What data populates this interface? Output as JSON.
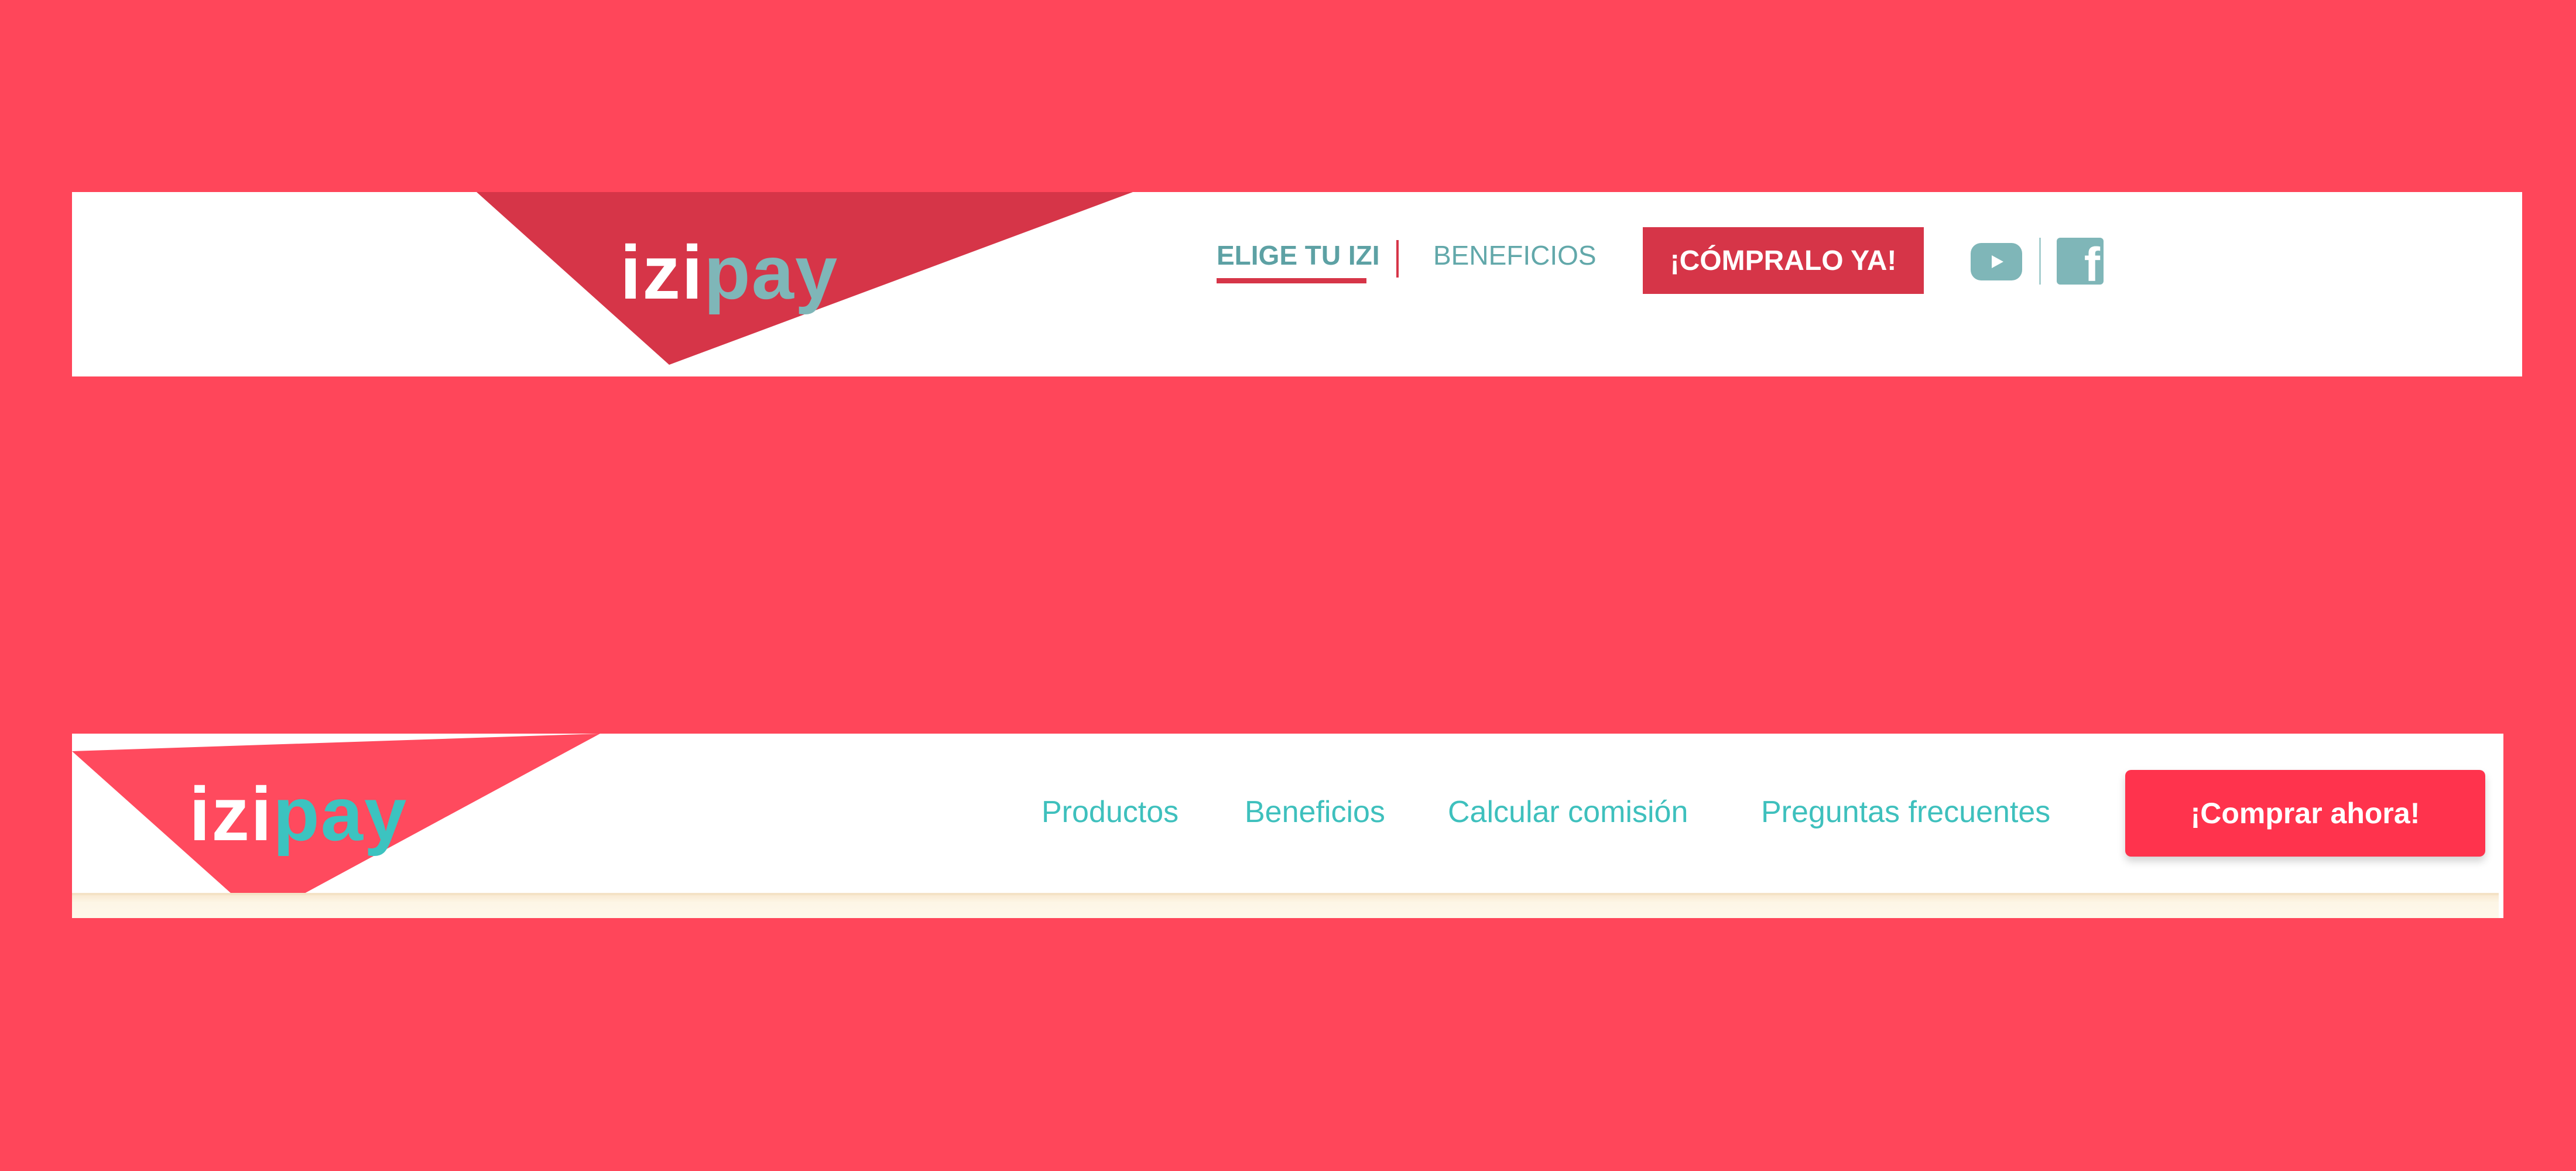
{
  "colors": {
    "page_background": "#ff465a",
    "header_background": "#ffffff",
    "header1_accent": "#d63548",
    "header1_teal": "#7fb6b8",
    "header2_accent": "#ff334d",
    "header2_teal": "#3ec0bd"
  },
  "header_old": {
    "logo": {
      "izi": "izi",
      "pay": "pay"
    },
    "nav": [
      {
        "label": "ELIGE TU IZI",
        "active": true
      },
      {
        "label": "BENEFICIOS",
        "active": false
      }
    ],
    "cta_label": "¡CÓMPRALO YA!",
    "social_icons": [
      "youtube-icon",
      "facebook-icon"
    ]
  },
  "header_new": {
    "logo": {
      "izi": "izi",
      "pay": "pay"
    },
    "nav": [
      {
        "label": "Productos"
      },
      {
        "label": "Beneficios"
      },
      {
        "label": "Calcular comisión"
      },
      {
        "label": "Preguntas frecuentes"
      }
    ],
    "cta_label": "¡Comprar ahora!"
  }
}
